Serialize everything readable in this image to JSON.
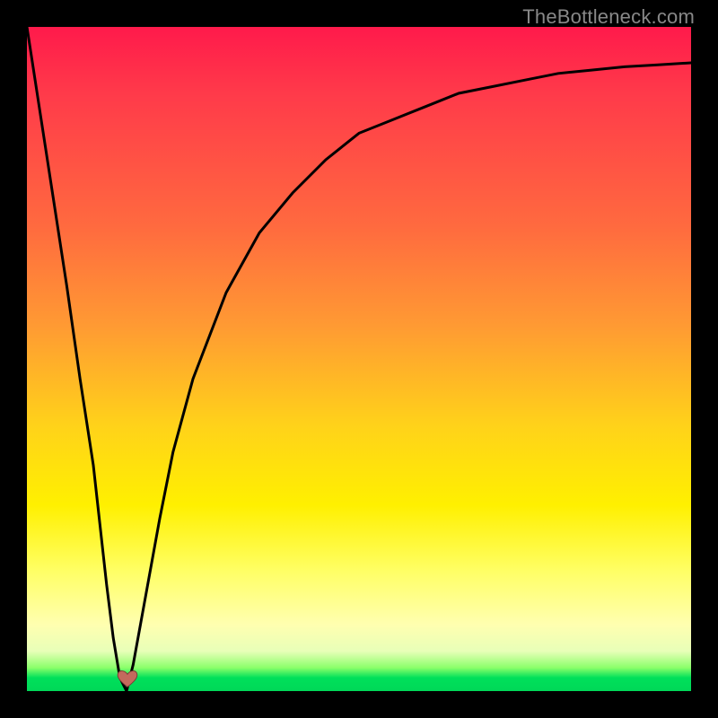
{
  "watermark": "TheBottleneck.com",
  "colors": {
    "curve": "#000000",
    "heart_fill": "#c46a5d",
    "heart_stroke": "#7a3b33"
  },
  "chart_data": {
    "type": "line",
    "title": "",
    "xlabel": "",
    "ylabel": "",
    "xlim": [
      0,
      100
    ],
    "ylim": [
      0,
      100
    ],
    "x": [
      0,
      2,
      4,
      6,
      8,
      10,
      12,
      13,
      14,
      15,
      16,
      18,
      20,
      22,
      25,
      30,
      35,
      40,
      45,
      50,
      55,
      60,
      65,
      70,
      75,
      80,
      85,
      90,
      95,
      100
    ],
    "values": [
      100,
      87,
      74,
      61,
      47,
      34,
      16,
      8,
      2,
      0,
      4,
      15,
      26,
      36,
      47,
      60,
      69,
      75,
      80,
      84,
      86,
      88,
      90,
      91,
      92,
      93,
      93.5,
      94,
      94.3,
      94.6
    ],
    "minimum": {
      "x": 15,
      "y": 0
    },
    "grid": false,
    "legend": false
  }
}
